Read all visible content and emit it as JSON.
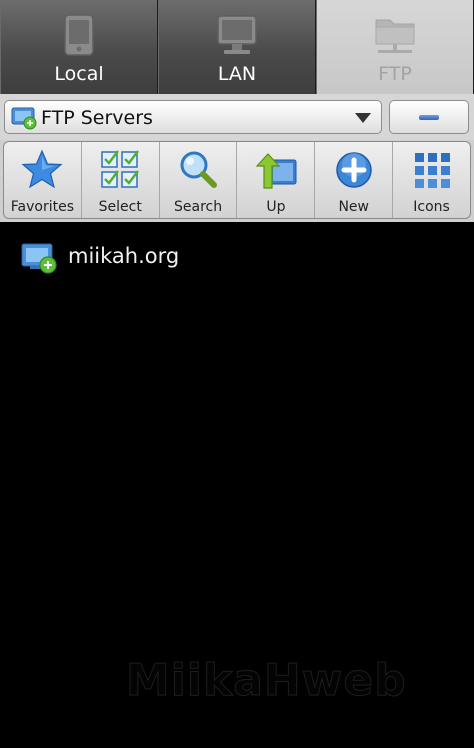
{
  "tabs": [
    {
      "label": "Local",
      "icon": "phone-icon",
      "selected": false
    },
    {
      "label": "LAN",
      "icon": "monitor-icon",
      "selected": false
    },
    {
      "label": "FTP",
      "icon": "network-folder-icon",
      "selected": true
    }
  ],
  "server_select": {
    "value": "FTP Servers",
    "icon": "ftp-server-icon"
  },
  "toolbar": {
    "items": [
      {
        "label": "Favorites",
        "icon": "star-icon"
      },
      {
        "label": "Select",
        "icon": "checkbox-grid-icon"
      },
      {
        "label": "Search",
        "icon": "magnifier-icon"
      },
      {
        "label": "Up",
        "icon": "up-arrow-folder-icon"
      },
      {
        "label": "New",
        "icon": "plus-circle-icon"
      },
      {
        "label": "Icons",
        "icon": "grid-view-icon"
      }
    ]
  },
  "files": [
    {
      "name": "miikah.org",
      "icon": "ftp-server-icon"
    }
  ],
  "watermark": "MiikaHweb",
  "colors": {
    "tab_bg": "#4b4b4b",
    "tab_selected_bg": "#d0d0d0",
    "toolbar_bg": "#e2e2e2",
    "list_bg": "#000000",
    "accent_blue": "#3a7bd5"
  }
}
